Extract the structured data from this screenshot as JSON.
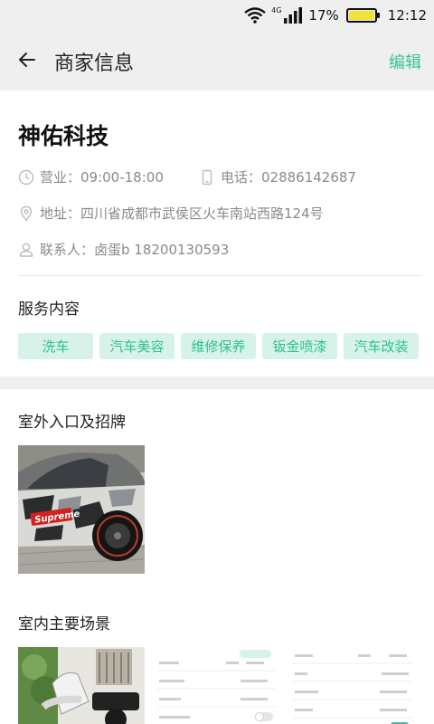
{
  "status_bar": {
    "network": "4G",
    "battery_percent": "17%",
    "time": "12:12"
  },
  "header": {
    "title": "商家信息",
    "edit_label": "编辑"
  },
  "merchant": {
    "name": "神佑科技",
    "hours": "营业：09:00-18:00",
    "phone": "电话：02886142687",
    "address": "地址：四川省成都市武侯区火车南站西路124号",
    "contact": "联系人：卤蛋b 18200130593"
  },
  "services": {
    "title": "服务内容",
    "tags": [
      "洗车",
      "汽车美容",
      "维修保养",
      "钣金喷漆",
      "汽车改装"
    ]
  },
  "photos": {
    "outdoor_title": "室外入口及招牌",
    "outdoor_sign_text": "Supreme",
    "indoor_title": "室内主要场景"
  },
  "colors": {
    "accent": "#35c49a",
    "tag_bg": "#d7f3e8",
    "tag_text": "#2fbf8f",
    "battery": "#f1e23a"
  }
}
